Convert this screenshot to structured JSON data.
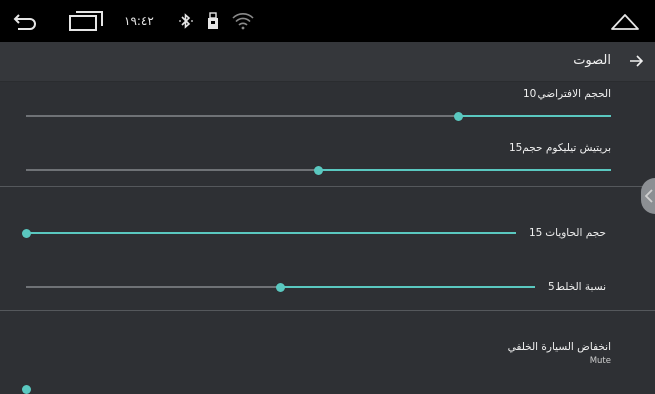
{
  "statusbar": {
    "time": "١٩:٤٢",
    "icons": [
      "back-icon",
      "recent-apps-icon",
      "bluetooth-icon",
      "usb-icon",
      "wifi-icon",
      "home-icon"
    ]
  },
  "header": {
    "title": "الصوت"
  },
  "settings": {
    "default_volume": {
      "label": "الحجم الافتراضي",
      "value": "10",
      "level": 0.74
    },
    "bt_call_volume": {
      "label": "بريتيش تيليكوم حجم",
      "value": "15",
      "level": 0.5
    },
    "media_volume": {
      "label": "حجم الحاويات",
      "value": "15",
      "level": 0.0
    },
    "mix_ratio": {
      "label": "نسبة الخلط",
      "value": "5",
      "level": 0.5
    },
    "reverse_reduction": {
      "label": "انخفاض السيارة الخلفي",
      "sub": "Mute"
    }
  },
  "colors": {
    "accent": "#5ac8c0",
    "track": "#6f7276",
    "background": "#2e3034",
    "statusbar": "#000000"
  }
}
